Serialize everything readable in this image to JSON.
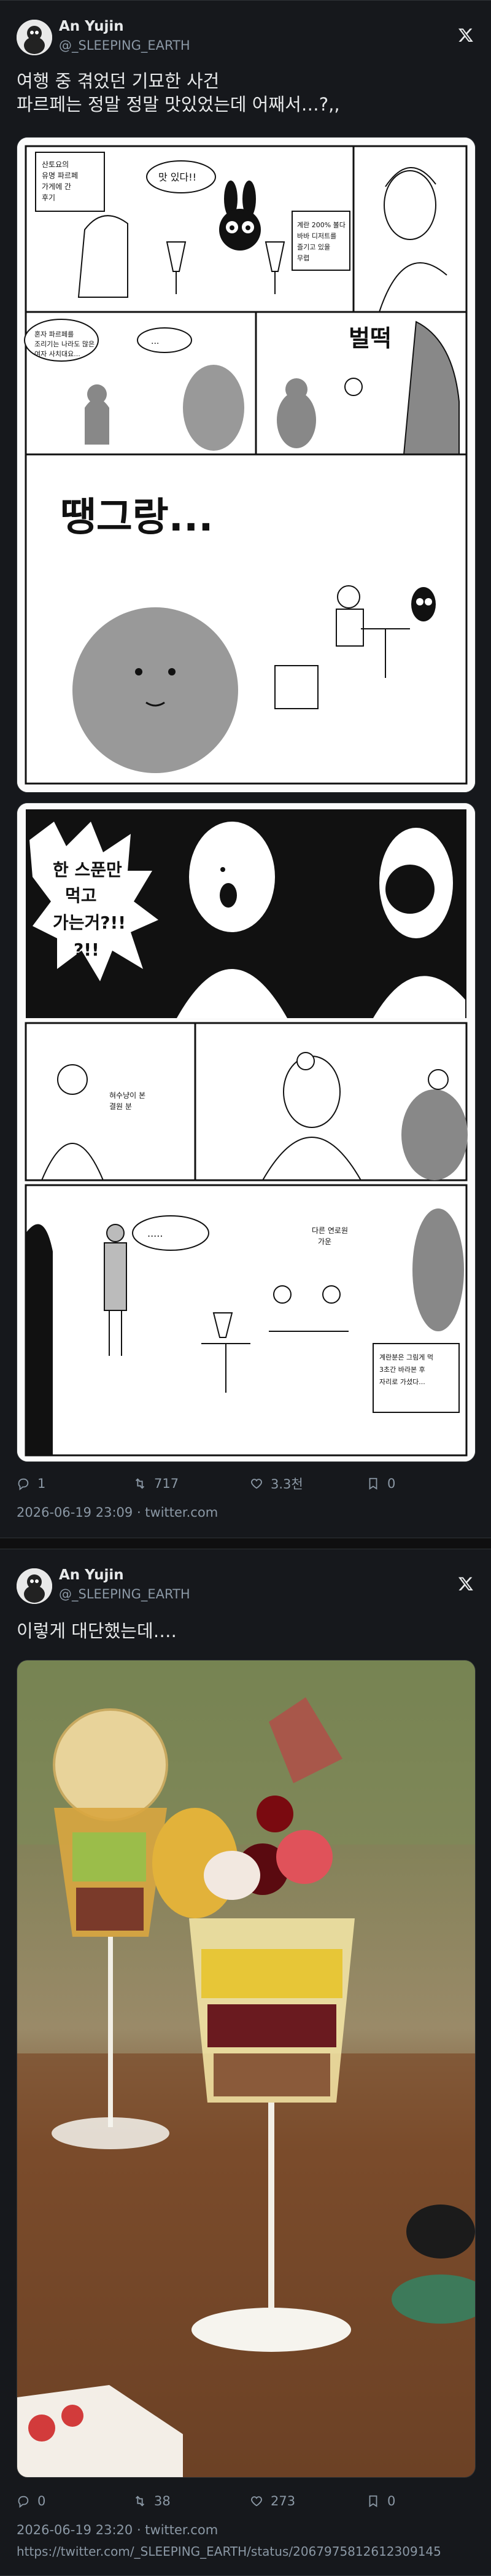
{
  "tweets": [
    {
      "author_name": "An Yujin",
      "handle": "@_SLEEPING_EARTH",
      "text": "여행 중 겪었던 기묘한 사건\n파르페는 정말 정말 맛있었는데 어째서…?,,",
      "comic": {
        "panel1_note_left": "산토요의 유명 파르페 가게에 간 후기",
        "panel1_bubble": "맛 있다!!",
        "panel1_note_right": "계란 200% 볼다 바바 디저트를 즐기고 있을 무렵",
        "panel2_note": "혼자 파르페를 조리기는 나라도 많은 여자 사치대요...",
        "panel2_bubble": "...",
        "panel3_sfx": "벌떡",
        "panel4_sfx": "땡그랑...",
        "panel5_shout": "한 스푼만 먹고 가는거?!! ?!!",
        "panel6_note": "혀수냥이 본 결원 분",
        "panel7_bubble_left": ".....",
        "panel7_note_mid": "다른 연로원 가운",
        "panel7_note_right": "계란분은 그림게 먹 3초간 바라본 후 자리로 가셨다..."
      },
      "replies": "1",
      "retweets": "717",
      "likes": "3.3천",
      "bookmarks": "0",
      "timestamp": "2026-06-19 23:09",
      "source": "twitter.com"
    },
    {
      "author_name": "An Yujin",
      "handle": "@_SLEEPING_EARTH",
      "text": "이렇게 대단했는데….",
      "replies": "0",
      "retweets": "38",
      "likes": "273",
      "bookmarks": "0",
      "timestamp": "2026-06-19 23:20",
      "source": "twitter.com",
      "url": "https://twitter.com/_SLEEPING_EARTH/status/2067975812612309145"
    }
  ],
  "colors": {
    "background": "#0f0f10",
    "card": "#16181c",
    "text": "#e7e9ea",
    "muted": "#8b98a5",
    "border": "#2f3336"
  },
  "icons": [
    "x-logo-icon",
    "reply-icon",
    "retweet-icon",
    "like-icon",
    "bookmark-icon"
  ]
}
